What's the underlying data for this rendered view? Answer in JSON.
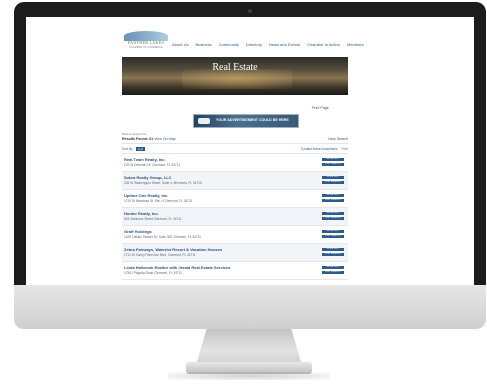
{
  "logo": {
    "name": "PANTHER LAKES",
    "tagline": "CHAMBER OF COMMERCE"
  },
  "nav": [
    "About Us",
    "Business",
    "Community",
    "Directory",
    "News and Events",
    "Chamber In Action",
    "Members"
  ],
  "banner": {
    "title": "Real Estate"
  },
  "print_link": "Print Page",
  "ad": {
    "text": "YOUR ADVERTISEMENT COULD BE HERE"
  },
  "listing": {
    "backlink": "Back to search list",
    "results_label": "Results Found: 61",
    "view_on_map": "View On Map",
    "new_search": "New Search",
    "sort_label": "Sort by:",
    "sort_options": [
      "A-Z"
    ],
    "compare": "Contact these businesses",
    "print": "Print",
    "row_button_1": "MORE INFO",
    "row_button_2": "VISIT WEBSITE",
    "rows": [
      {
        "name": "Real Team Realty, Inc.",
        "address": "229 W Deborah Dr, Clermont, FL 34711"
      },
      {
        "name": "Subra Realty Group, LLC",
        "address": "235 W Washington Street, Suite 4, Minneola, FL 34715"
      },
      {
        "name": "Uptime One Realty, Inc.",
        "address": "1719 W Montrose St, Ste. H Clermont, FL 34711"
      },
      {
        "name": "Hunter Realty, Inc.",
        "address": "824 Montrose Street Clermont, FL 34711"
      },
      {
        "name": "Graff Holdings",
        "address": "1429 Oakley Seaver Dr, Suite 300 Clermont, FL 34711"
      },
      {
        "name": "Zebra Fairways, Waterlot Resort & Vacation Houses",
        "address": "1711 W Sunny Palm Ave Blvd, Clermont, FL 34711"
      },
      {
        "name": "Linda Holbrook Realtor with Jerald Real Estate Services",
        "address": "17501 Pagoda Road Clermont, FL 34711"
      }
    ]
  }
}
